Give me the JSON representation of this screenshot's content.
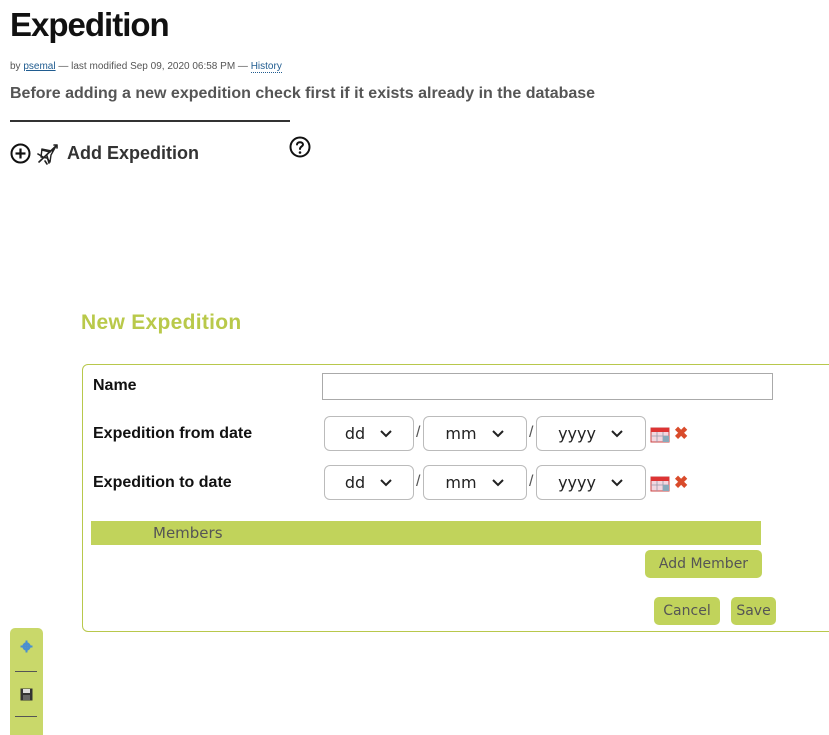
{
  "page": {
    "title": "Expedition",
    "byline": {
      "prefix": "by",
      "author": "psemal",
      "modified_text": " — last modified Sep 09, 2020 06:58 PM — ",
      "history_label": "History"
    },
    "description": "Before adding a new expedition check first if it exists already in the database"
  },
  "actions": {
    "add_label": "Add Expedition",
    "icons": [
      "plus-circle-icon",
      "plane-icon",
      "help-icon"
    ]
  },
  "form": {
    "heading": "New Expedition",
    "name_label": "Name",
    "name_value": "",
    "from_date": {
      "label": "Expedition from date",
      "day": "dd",
      "month": "mm",
      "year": "yyyy",
      "separator": "/"
    },
    "to_date": {
      "label": "Expedition to date",
      "day": "dd",
      "month": "mm",
      "year": "yyyy",
      "separator": "/"
    },
    "members_label": "Members",
    "add_member_label": "Add Member",
    "cancel_label": "Cancel",
    "save_label": "Save"
  },
  "toolbar": {
    "icons": [
      "gear-icon",
      "save-icon"
    ]
  },
  "colors": {
    "accent": "#c1d35b",
    "heading": "#b9c94a",
    "clear": "#d94b2b"
  }
}
